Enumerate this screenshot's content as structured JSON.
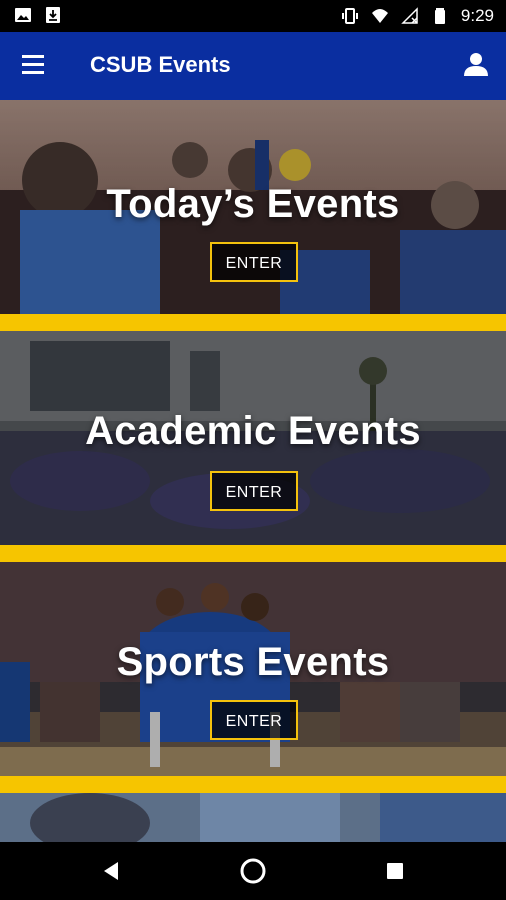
{
  "status_bar": {
    "time": "9:29",
    "left_icons": [
      "image-icon",
      "download-icon"
    ],
    "right_icons": [
      "vibrate-icon",
      "wifi-icon",
      "no-signal-icon",
      "battery-icon"
    ]
  },
  "app_bar": {
    "title": "CSUB Events",
    "menu_icon": "hamburger-menu-icon",
    "profile_icon": "person-icon"
  },
  "panels": [
    {
      "title": "Today’s Events",
      "button_label": "ENTER"
    },
    {
      "title": "Academic Events",
      "button_label": "ENTER"
    },
    {
      "title": "Sports Events",
      "button_label": "ENTER"
    }
  ],
  "colors": {
    "app_bar": "#0a2ea0",
    "accent_gold": "#f6c500",
    "button_border": "#f4c20d"
  },
  "nav_bar": {
    "icons": [
      "back-icon",
      "home-icon",
      "recents-icon"
    ]
  }
}
